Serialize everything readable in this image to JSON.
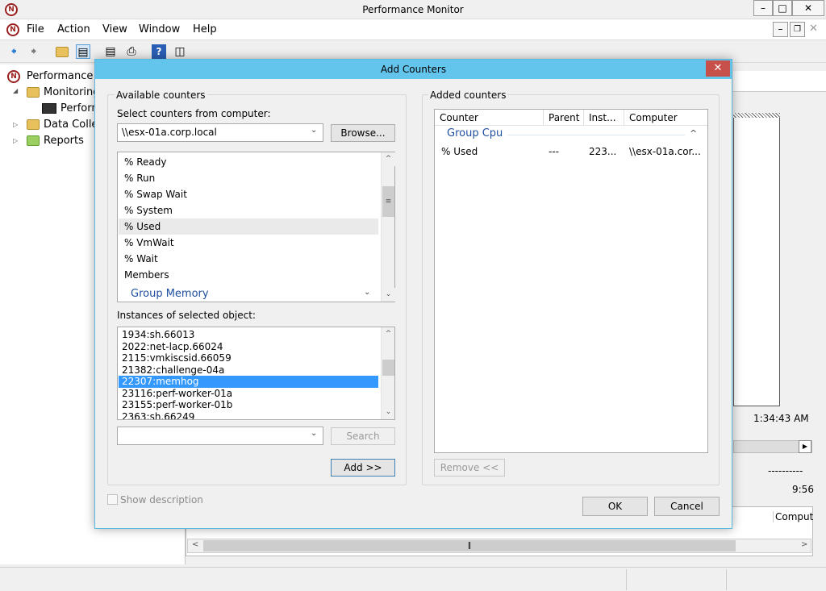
{
  "window": {
    "title": "Performance Monitor",
    "app_icon": "performance-monitor-icon"
  },
  "menu": [
    "File",
    "Action",
    "View",
    "Window",
    "Help"
  ],
  "tree": {
    "root": "Performance",
    "monitoring": "Monitoring",
    "perf_monitor": "Perform",
    "data_collector": "Data Colle",
    "reports": "Reports"
  },
  "background": {
    "time": "1:34:43 AM",
    "dashes": "----------",
    "duration": "9:56",
    "column": "Comput"
  },
  "dialog": {
    "title": "Add Counters",
    "available_label": "Available counters",
    "select_computer_label": "Select counters from computer:",
    "computer_value": "\\\\esx-01a.corp.local",
    "browse_label": "Browse...",
    "counters": [
      "% Ready",
      "% Run",
      "% Swap Wait",
      "% System",
      "% Used",
      "% VmWait",
      "% Wait",
      "Members"
    ],
    "next_group": "Group Memory",
    "instances_label": "Instances of selected object:",
    "instances": [
      "1934:sh.66013",
      "2022:net-lacp.66024",
      "2115:vmkiscsid.66059",
      "21382:challenge-04a",
      "22307:memhog",
      "23116:perf-worker-01a",
      "23155:perf-worker-01b",
      "2363:sh.66249"
    ],
    "search_value": "",
    "search_label": "Search",
    "add_label": "Add >>",
    "added_label": "Added counters",
    "added_columns": [
      "Counter",
      "Parent",
      "Inst...",
      "Computer"
    ],
    "added_group": "Group Cpu",
    "added_rows": [
      {
        "counter": "% Used",
        "parent": "---",
        "instance": "223...",
        "computer": "\\\\esx-01a.cor..."
      }
    ],
    "remove_label": "Remove <<",
    "show_description": "Show description",
    "ok_label": "OK",
    "cancel_label": "Cancel"
  },
  "colors": {
    "dialog_title": "#63c4ec",
    "selection": "#3399ff",
    "close": "#c7504a",
    "group_text": "#1f4fa0"
  }
}
